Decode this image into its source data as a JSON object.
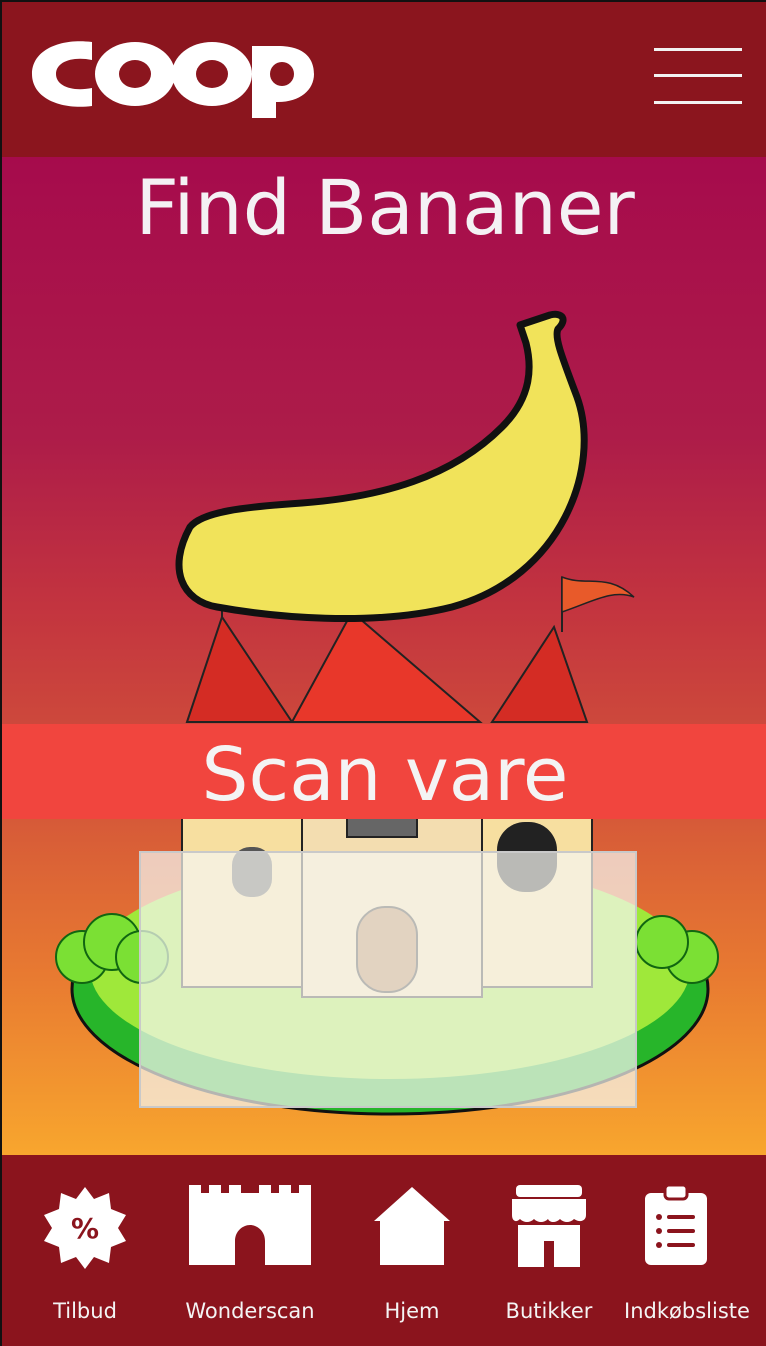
{
  "header": {
    "logo_text": "coop",
    "menu_icon": "hamburger-menu-icon"
  },
  "main": {
    "title": "Find Bananer",
    "product_icon": "banana-icon",
    "background_scene": "castle-illustration"
  },
  "scan": {
    "label": "Scan vare"
  },
  "nav": {
    "items": [
      {
        "label": "Tilbud",
        "icon": "percent-badge-icon"
      },
      {
        "label": "Wonderscan",
        "icon": "castle-icon"
      },
      {
        "label": "Hjem",
        "icon": "home-icon"
      },
      {
        "label": "Butikker",
        "icon": "store-icon"
      },
      {
        "label": "Indkøbsliste",
        "icon": "clipboard-list-icon"
      }
    ]
  },
  "colors": {
    "header_bg": "#8b151e",
    "scan_bar": "#f1453e",
    "text": "#f4f4f4"
  }
}
